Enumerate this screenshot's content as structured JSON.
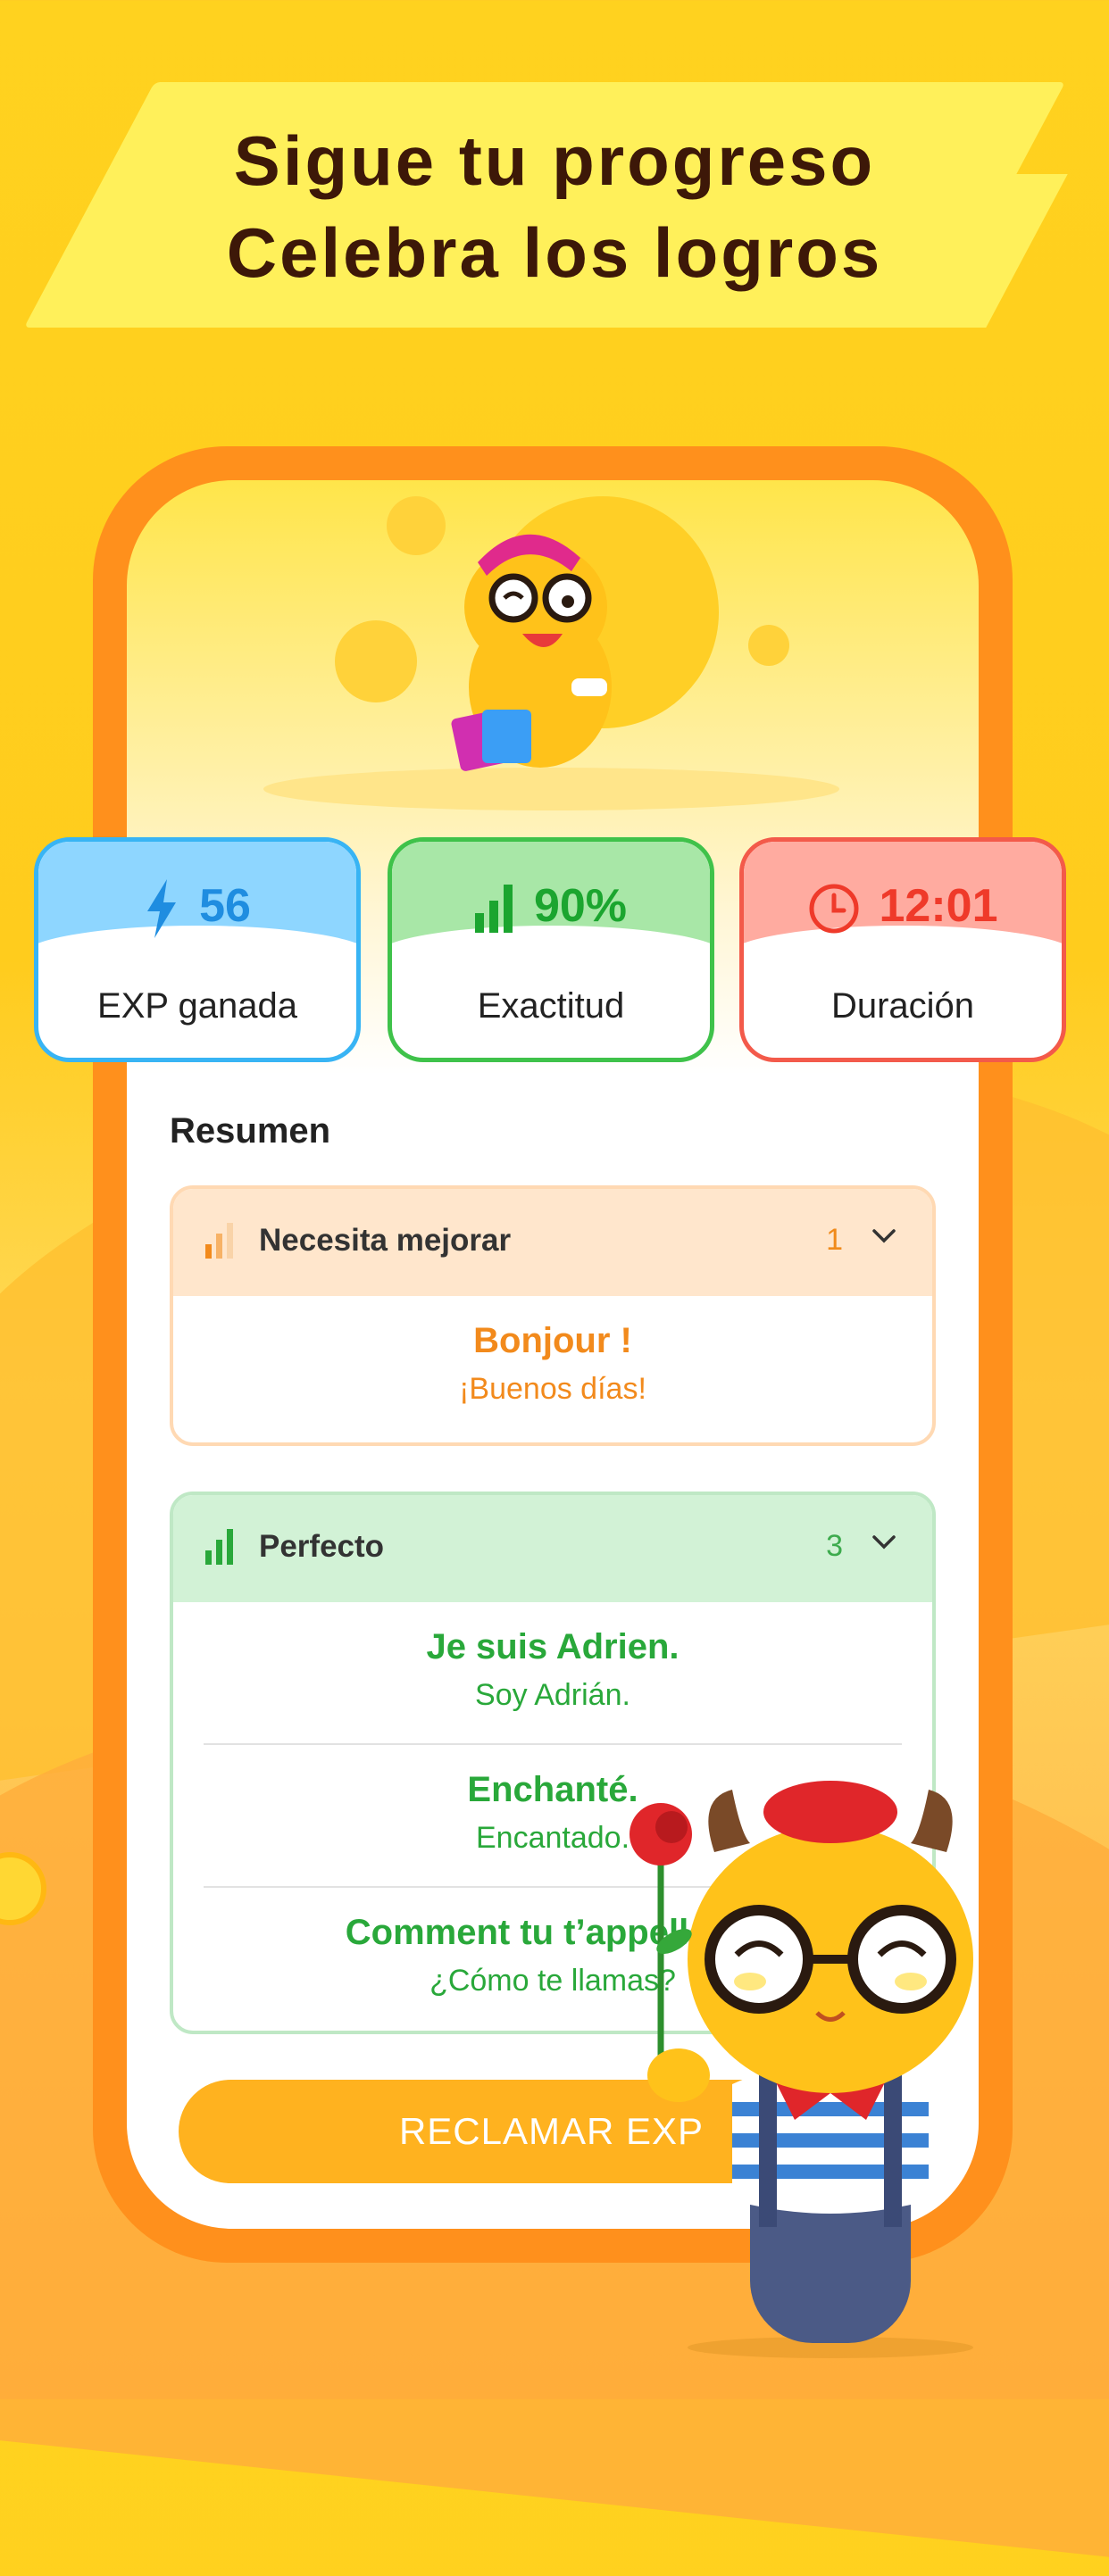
{
  "headline": {
    "line1": "Sigue tu progreso",
    "line2": "Celebra los logros"
  },
  "stats": [
    {
      "icon": "lightning-icon",
      "value": "56",
      "label": "EXP ganada",
      "color": "#1f8de0"
    },
    {
      "icon": "bar-chart-icon",
      "value": "90%",
      "label": "Exactitud",
      "color": "#1ba52f"
    },
    {
      "icon": "clock-icon",
      "value": "12:01",
      "label": "Duración",
      "color": "#ef3a2a"
    }
  ],
  "summary": {
    "title": "Resumen",
    "groups": [
      {
        "title": "Necesita mejorar",
        "count": "1",
        "accent": "#f28a1c",
        "items": [
          {
            "fr": "Bonjour !",
            "es": "¡Buenos días!"
          }
        ]
      },
      {
        "title": "Perfecto",
        "count": "3",
        "accent": "#29a83a",
        "items": [
          {
            "fr": "Je suis Adrien.",
            "es": "Soy Adrián."
          },
          {
            "fr": "Enchanté.",
            "es": "Encantado."
          },
          {
            "fr": "Comment tu t’appelles ?",
            "es": "¿Cómo te llamas?"
          }
        ]
      }
    ]
  },
  "claim_button": "RECLAMAR EXP"
}
